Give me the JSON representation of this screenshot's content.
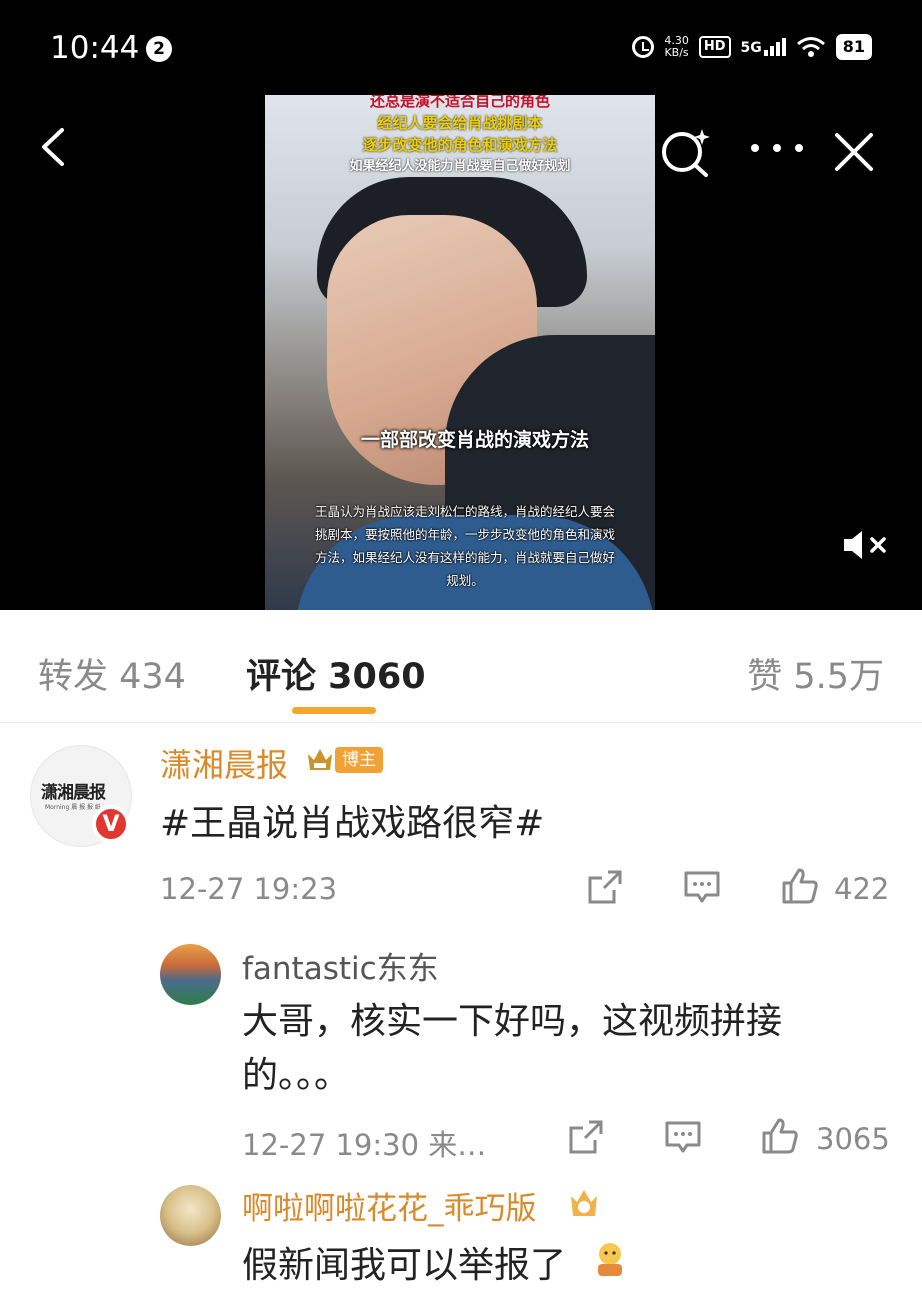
{
  "status_bar": {
    "time": "10:44",
    "notification_count": "2",
    "net_speed_value": "4.30",
    "net_speed_unit": "KB/s",
    "hd": "HD",
    "network": "5G",
    "battery": "81"
  },
  "video": {
    "caption_top_1": "还总是演不适合自己的角色",
    "caption_top_2": "经纪人要会给肖战挑剧本",
    "caption_top_3": "逐步改变他的角色和演戏方法",
    "caption_top_4": "如果经纪人没能力肖战要自己做好规划",
    "caption_mid": "一部部改变肖战的演戏方法",
    "caption_bottom": "王晶认为肖战应该走刘松仁的路线，肖战的经纪人要会挑剧本，要按照他的年龄，一步步改变他的角色和演戏方法，如果经纪人没有这样的能力，肖战就要自己做好规划。"
  },
  "tabs": {
    "repost": "转发 434",
    "comment": "评论 3060",
    "like": "赞 5.5万"
  },
  "comments": [
    {
      "avatar_text": "潇湘晨报",
      "avatar_sub": "Morning 晨 报 报 纸",
      "verified": "V",
      "user": "潇湘晨报",
      "tag": "博主",
      "text": "#王晶说肖战戏路很窄#",
      "time": "12-27 19:23",
      "likes": "422"
    }
  ],
  "replies": [
    {
      "user": "fantastic东东",
      "text": "大哥，核实一下好吗，这视频拼接的。。。",
      "time": "12-27 19:30 来…",
      "likes": "3065"
    },
    {
      "user": "啊啦啊啦花花_乖巧版",
      "text": "假新闻我可以举报了"
    }
  ],
  "colors": {
    "accent": "#f7a52e",
    "username_orange": "#d98a2b",
    "gray_text": "#8a8a8a",
    "verified_red": "#e1372f"
  }
}
